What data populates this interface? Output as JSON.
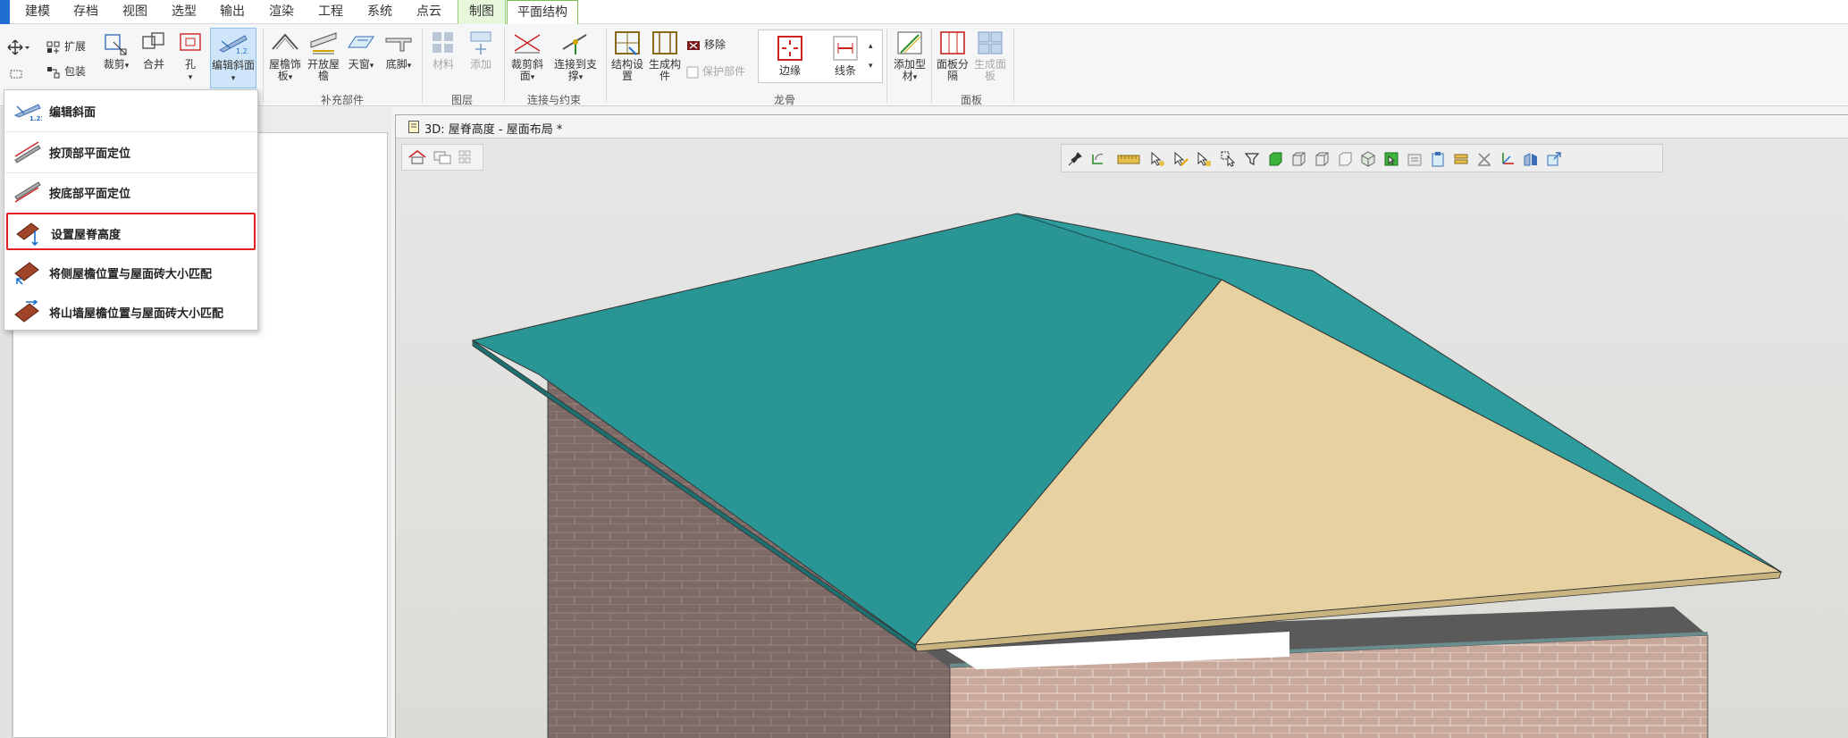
{
  "menu": {
    "tabs": [
      "建模",
      "存档",
      "视图",
      "选型",
      "输出",
      "渲染",
      "工程",
      "系统",
      "点云"
    ],
    "context_tabs": [
      "制图",
      "平面结构"
    ],
    "active_tab": "平面结构"
  },
  "ribbon": {
    "expand": "扩展",
    "wrap": "包装",
    "cut": "裁剪",
    "merge": "合并",
    "hole": "孔",
    "edit_slope": "编辑斜面",
    "eave_trim": "屋檐饰板",
    "open_eave": "开放屋檐",
    "skylight": "天窗",
    "bottom_foot": "底脚",
    "material": "材料",
    "add": "添加",
    "cut_slope": "裁剪斜面",
    "connect_support": "连接到支撑",
    "struct_settings": "结构设置",
    "gen_members": "生成构件",
    "remove": "移除",
    "protect_parts": "保护部件",
    "edge": "边缘",
    "line": "线条",
    "add_profile": "添加型材",
    "panel_split": "面板分隔",
    "gen_panel": "生成面板",
    "groups": {
      "supplement": "补充部件",
      "layers": "图层",
      "connect": "连接与约束",
      "keel": "龙骨",
      "panel": "面板"
    }
  },
  "dropdown": {
    "items": [
      "编辑斜面",
      "按顶部平面定位",
      "按底部平面定位",
      "设置屋脊高度",
      "将侧屋檐位置与屋面砖大小匹配",
      "将山墙屋檐位置与屋面砖大小匹配"
    ],
    "highlighted": "设置屋脊高度"
  },
  "view": {
    "title": "3D: 屋脊高度 - 屋面布局 *"
  },
  "colors": {
    "accent": "#1e6fd0",
    "context_tab": "#e6f7dc",
    "highlight_border": "#e02020",
    "roof_teal": "#2a9d9d",
    "roof_beige": "#e8d1a0",
    "brick": "#c9a89c"
  }
}
